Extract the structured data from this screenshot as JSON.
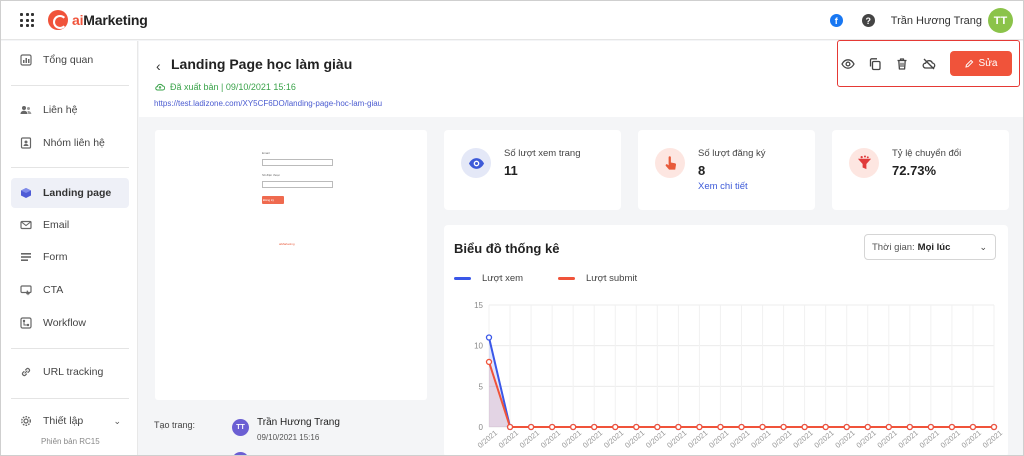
{
  "app": {
    "brand_prefix": "ai",
    "brand_suffix": "Marketing"
  },
  "topbar": {
    "user_name": "Trần Hương Trang",
    "avatar_initials": "TT"
  },
  "sidebar": {
    "items": [
      {
        "label": "Tổng quan",
        "icon": "dashboard-icon"
      },
      {
        "label": "Liên hệ",
        "icon": "contacts-icon"
      },
      {
        "label": "Nhóm liên hệ",
        "icon": "contact-group-icon"
      },
      {
        "label": "Landing page",
        "icon": "landing-page-icon"
      },
      {
        "label": "Email",
        "icon": "email-icon"
      },
      {
        "label": "Form",
        "icon": "form-icon"
      },
      {
        "label": "CTA",
        "icon": "cta-icon"
      },
      {
        "label": "Workflow",
        "icon": "workflow-icon"
      },
      {
        "label": "URL tracking",
        "icon": "link-icon"
      },
      {
        "label": "Thiết lập",
        "icon": "settings-icon"
      }
    ],
    "version": "Phiên bản RC15"
  },
  "page": {
    "title": "Landing Page học làm giàu",
    "status": "Đã xuất bản | 09/10/2021 15:16",
    "url": "https://test.ladizone.com/XY5CF6DO/landing-page-hoc-lam-giau",
    "edit_label": "Sửa"
  },
  "preview": {
    "email_label": "Email",
    "phone_label": "Số điện thoại",
    "button_label": "Đăng ký",
    "footer_brand": "aiMarketing"
  },
  "creator": {
    "label": "Tạo trang:",
    "initials": "TT",
    "name": "Trần Hương Trang",
    "date": "09/10/2021 15:16"
  },
  "stats": [
    {
      "label": "Số lượt xem trang",
      "value": "11",
      "icon": "eye-icon",
      "color": "#3d5ad8",
      "bg": "#e4e8f7"
    },
    {
      "label": "Số lượt đăng ký",
      "value": "8",
      "link": "Xem chi tiết",
      "icon": "hand-pointer-icon",
      "color": "#e85a3a",
      "bg": "#fde6e1"
    },
    {
      "label": "Tỷ lệ chuyển đổi",
      "value": "72.73%",
      "icon": "funnel-icon",
      "color": "#e03a3a",
      "bg": "#fde6e1"
    }
  ],
  "chart": {
    "title": "Biểu đồ thống kê",
    "time_label": "Thời gian:",
    "time_value": "Mọi lúc"
  },
  "chart_data": {
    "type": "line",
    "title": "Biểu đồ thống kê",
    "ylim": [
      0,
      15
    ],
    "yticks": [
      0,
      5,
      10,
      15
    ],
    "x": [
      "0/2021",
      "0/2021",
      "0/2021",
      "0/2021",
      "0/2021",
      "0/2021",
      "0/2021",
      "0/2021",
      "0/2021",
      "0/2021",
      "0/2021",
      "0/2021",
      "0/2021",
      "0/2021",
      "0/2021",
      "0/2021",
      "0/2021",
      "0/2021",
      "0/2021",
      "0/2021",
      "0/2021",
      "0/2021",
      "0/2021",
      "0/2021",
      "0/2021"
    ],
    "series": [
      {
        "name": "Lượt xem",
        "color": "#3a57e8",
        "values": [
          11,
          0,
          0,
          0,
          0,
          0,
          0,
          0,
          0,
          0,
          0,
          0,
          0,
          0,
          0,
          0,
          0,
          0,
          0,
          0,
          0,
          0,
          0,
          0,
          0
        ]
      },
      {
        "name": "Lượt submit",
        "color": "#f0533a",
        "values": [
          8,
          0,
          0,
          0,
          0,
          0,
          0,
          0,
          0,
          0,
          0,
          0,
          0,
          0,
          0,
          0,
          0,
          0,
          0,
          0,
          0,
          0,
          0,
          0,
          0
        ]
      }
    ],
    "legend": "top-left",
    "grid": true
  }
}
